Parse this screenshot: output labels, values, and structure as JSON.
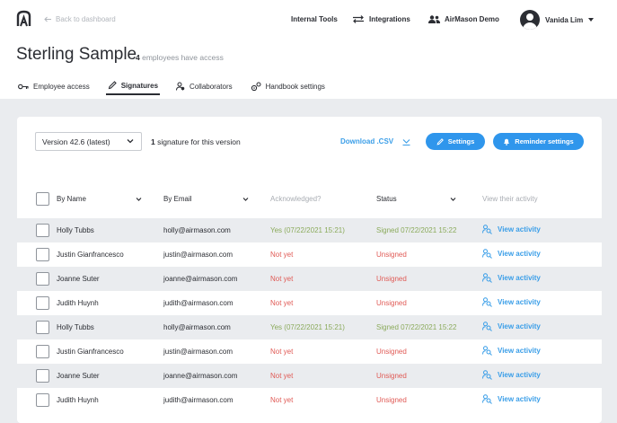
{
  "nav": {
    "back_label": "Back to dashboard",
    "internal_tools": "Internal Tools",
    "integrations": "Integrations",
    "org": "AirMason Demo",
    "user_name": "Vanida Lim"
  },
  "header": {
    "title": "Sterling Sample",
    "access_count": "4",
    "access_text": "employees have access"
  },
  "tabs": [
    {
      "label": "Employee access",
      "icon": "key-icon"
    },
    {
      "label": "Signatures",
      "icon": "pen-icon"
    },
    {
      "label": "Collaborators",
      "icon": "users-icon"
    },
    {
      "label": "Handbook settings",
      "icon": "gears-icon"
    }
  ],
  "toolbar": {
    "version": "Version 42.6 (latest)",
    "sig_count": "1",
    "sig_text": "signature for this version",
    "download_label": "Download .CSV",
    "settings_label": "Settings",
    "reminder_label": "Reminder settings"
  },
  "table": {
    "headers": {
      "name": "By Name",
      "email": "By Email",
      "ack": "Acknowledged?",
      "status": "Status",
      "activity": "View their activity"
    },
    "rows": [
      {
        "name": "Holly Tubbs",
        "email": "holly@airmason.com",
        "ack": "Yes (07/22/2021 15:21)",
        "status": "Signed 07/22/2021 15:22",
        "activity": "View activity",
        "signed": true
      },
      {
        "name": "Justin Gianfrancesco",
        "email": "justin@airmason.com",
        "ack": "Not yet",
        "status": "Unsigned",
        "activity": "View activity",
        "signed": false
      },
      {
        "name": "Joanne Suter",
        "email": "joanne@airmason.com",
        "ack": "Not yet",
        "status": "Unsigned",
        "activity": "View activity",
        "signed": false
      },
      {
        "name": "Judith Huynh",
        "email": "judith@airmason.com",
        "ack": "Not yet",
        "status": "Unsigned",
        "activity": "View activity",
        "signed": false
      },
      {
        "name": "Holly Tubbs",
        "email": "holly@airmason.com",
        "ack": "Yes (07/22/2021 15:21)",
        "status": "Signed 07/22/2021 15:22",
        "activity": "View activity",
        "signed": true
      },
      {
        "name": "Justin Gianfrancesco",
        "email": "justin@airmason.com",
        "ack": "Not yet",
        "status": "Unsigned",
        "activity": "View activity",
        "signed": false
      },
      {
        "name": "Joanne Suter",
        "email": "joanne@airmason.com",
        "ack": "Not yet",
        "status": "Unsigned",
        "activity": "View activity",
        "signed": false
      },
      {
        "name": "Judith Huynh",
        "email": "judith@airmason.com",
        "ack": "Not yet",
        "status": "Unsigned",
        "activity": "View activity",
        "signed": false
      }
    ]
  },
  "colors": {
    "accent": "#2f96ec",
    "link": "#3a9ee8",
    "signed": "#8aaa5a",
    "unsigned": "#e05a55",
    "alt_row": "#eaecef"
  }
}
